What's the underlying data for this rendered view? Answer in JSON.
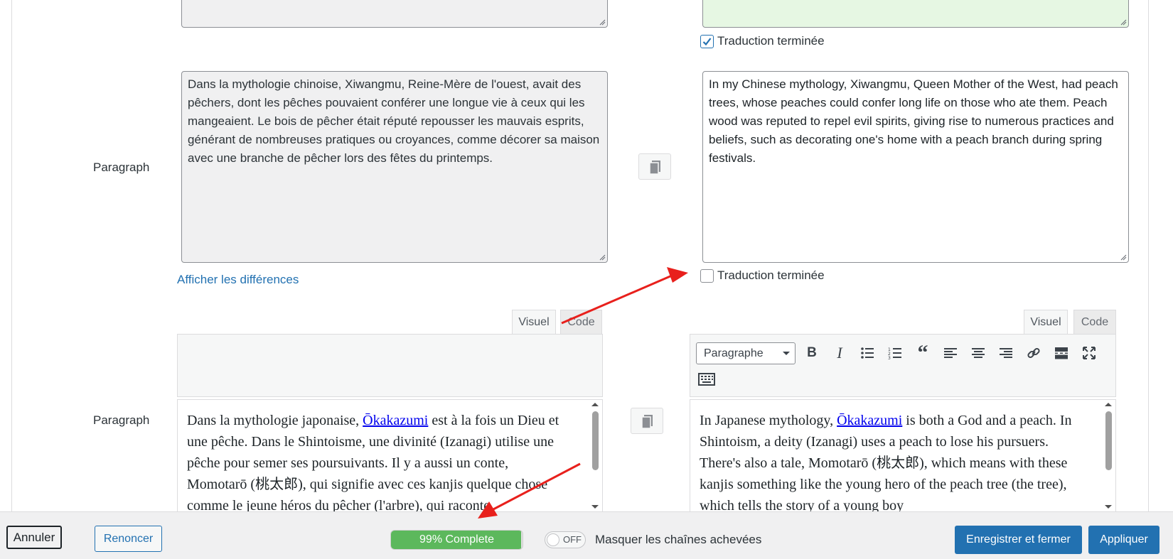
{
  "colors": {
    "accent": "#2271b1",
    "progress_fill": "#5cb85c",
    "done_textarea_bg": "#e6f7e3",
    "readonly_textarea_bg": "#f0f0f1",
    "annotation_arrow": "#e8201c"
  },
  "row1": {
    "translation_done_label": "Traduction terminée",
    "translation_done_checked": true
  },
  "row2": {
    "field_label": "Paragraph",
    "source_text": "Dans la mythologie chinoise, Xiwangmu, Reine-Mère de l'ouest, avait des pêchers, dont les pêches pouvaient conférer une longue vie à ceux qui les mangeaient. Le bois de pêcher était réputé repousser les mauvais esprits, générant de nombreuses pratiques ou croyances, comme décorer sa maison avec une branche de pêcher lors des fêtes du printemps.",
    "translation_text": "In my Chinese mythology, Xiwangmu, Queen Mother of the West, had peach trees, whose peaches could confer long life on those who ate them. Peach wood was reputed to repel evil spirits, giving rise to numerous practices and beliefs, such as decorating one's home with a peach branch during spring festivals.",
    "show_diff_link": "Afficher les différences",
    "translation_done_label": "Traduction terminée",
    "translation_done_checked": false
  },
  "row3": {
    "field_label": "Paragraph",
    "left_tabs": {
      "visual": "Visuel",
      "code": "Code"
    },
    "right_tabs": {
      "visual": "Visuel",
      "code": "Code"
    },
    "format_select_value": "Paragraphe",
    "toolbar_icons": [
      "bold-icon",
      "italic-icon",
      "bullet-list-icon",
      "numbered-list-icon",
      "blockquote-icon",
      "align-left-icon",
      "align-center-icon",
      "align-right-icon",
      "link-icon",
      "read-more-icon",
      "fullscreen-icon",
      "toolbar-toggle-icon"
    ],
    "source": {
      "before_link": "Dans la mythologie japonaise, ",
      "link": "Ōkakazumi",
      "after_link": " est à la fois un Dieu et une pêche. Dans le Shintoisme, une divinité (Izanagi) utilise une pêche pour semer ses poursuivants. Il y a aussi un conte, Momotarō (桃太郎), qui signifie avec ces kanjis quelque chose comme le jeune héros du pêcher (l'arbre), qui raconte"
    },
    "translation": {
      "before_link": "In Japanese mythology, ",
      "link": "Ōkakazumi",
      "after_link": " is both a God and a peach. In Shintoism, a deity (Izanagi) uses a peach to lose his pursuers. There's also a tale, Momotarō (桃太郎), which means with these kanjis something like the young hero of the peach tree (the tree), which tells the story of a young boy"
    }
  },
  "footer": {
    "cancel_label": "Annuler",
    "renounce_label": "Renoncer",
    "progress_percent": 99,
    "progress_text": "99% Complete",
    "toggle_state": "OFF",
    "hide_completed_label": "Masquer les chaînes achevées",
    "save_close_label": "Enregistrer et fermer",
    "apply_label": "Appliquer"
  }
}
